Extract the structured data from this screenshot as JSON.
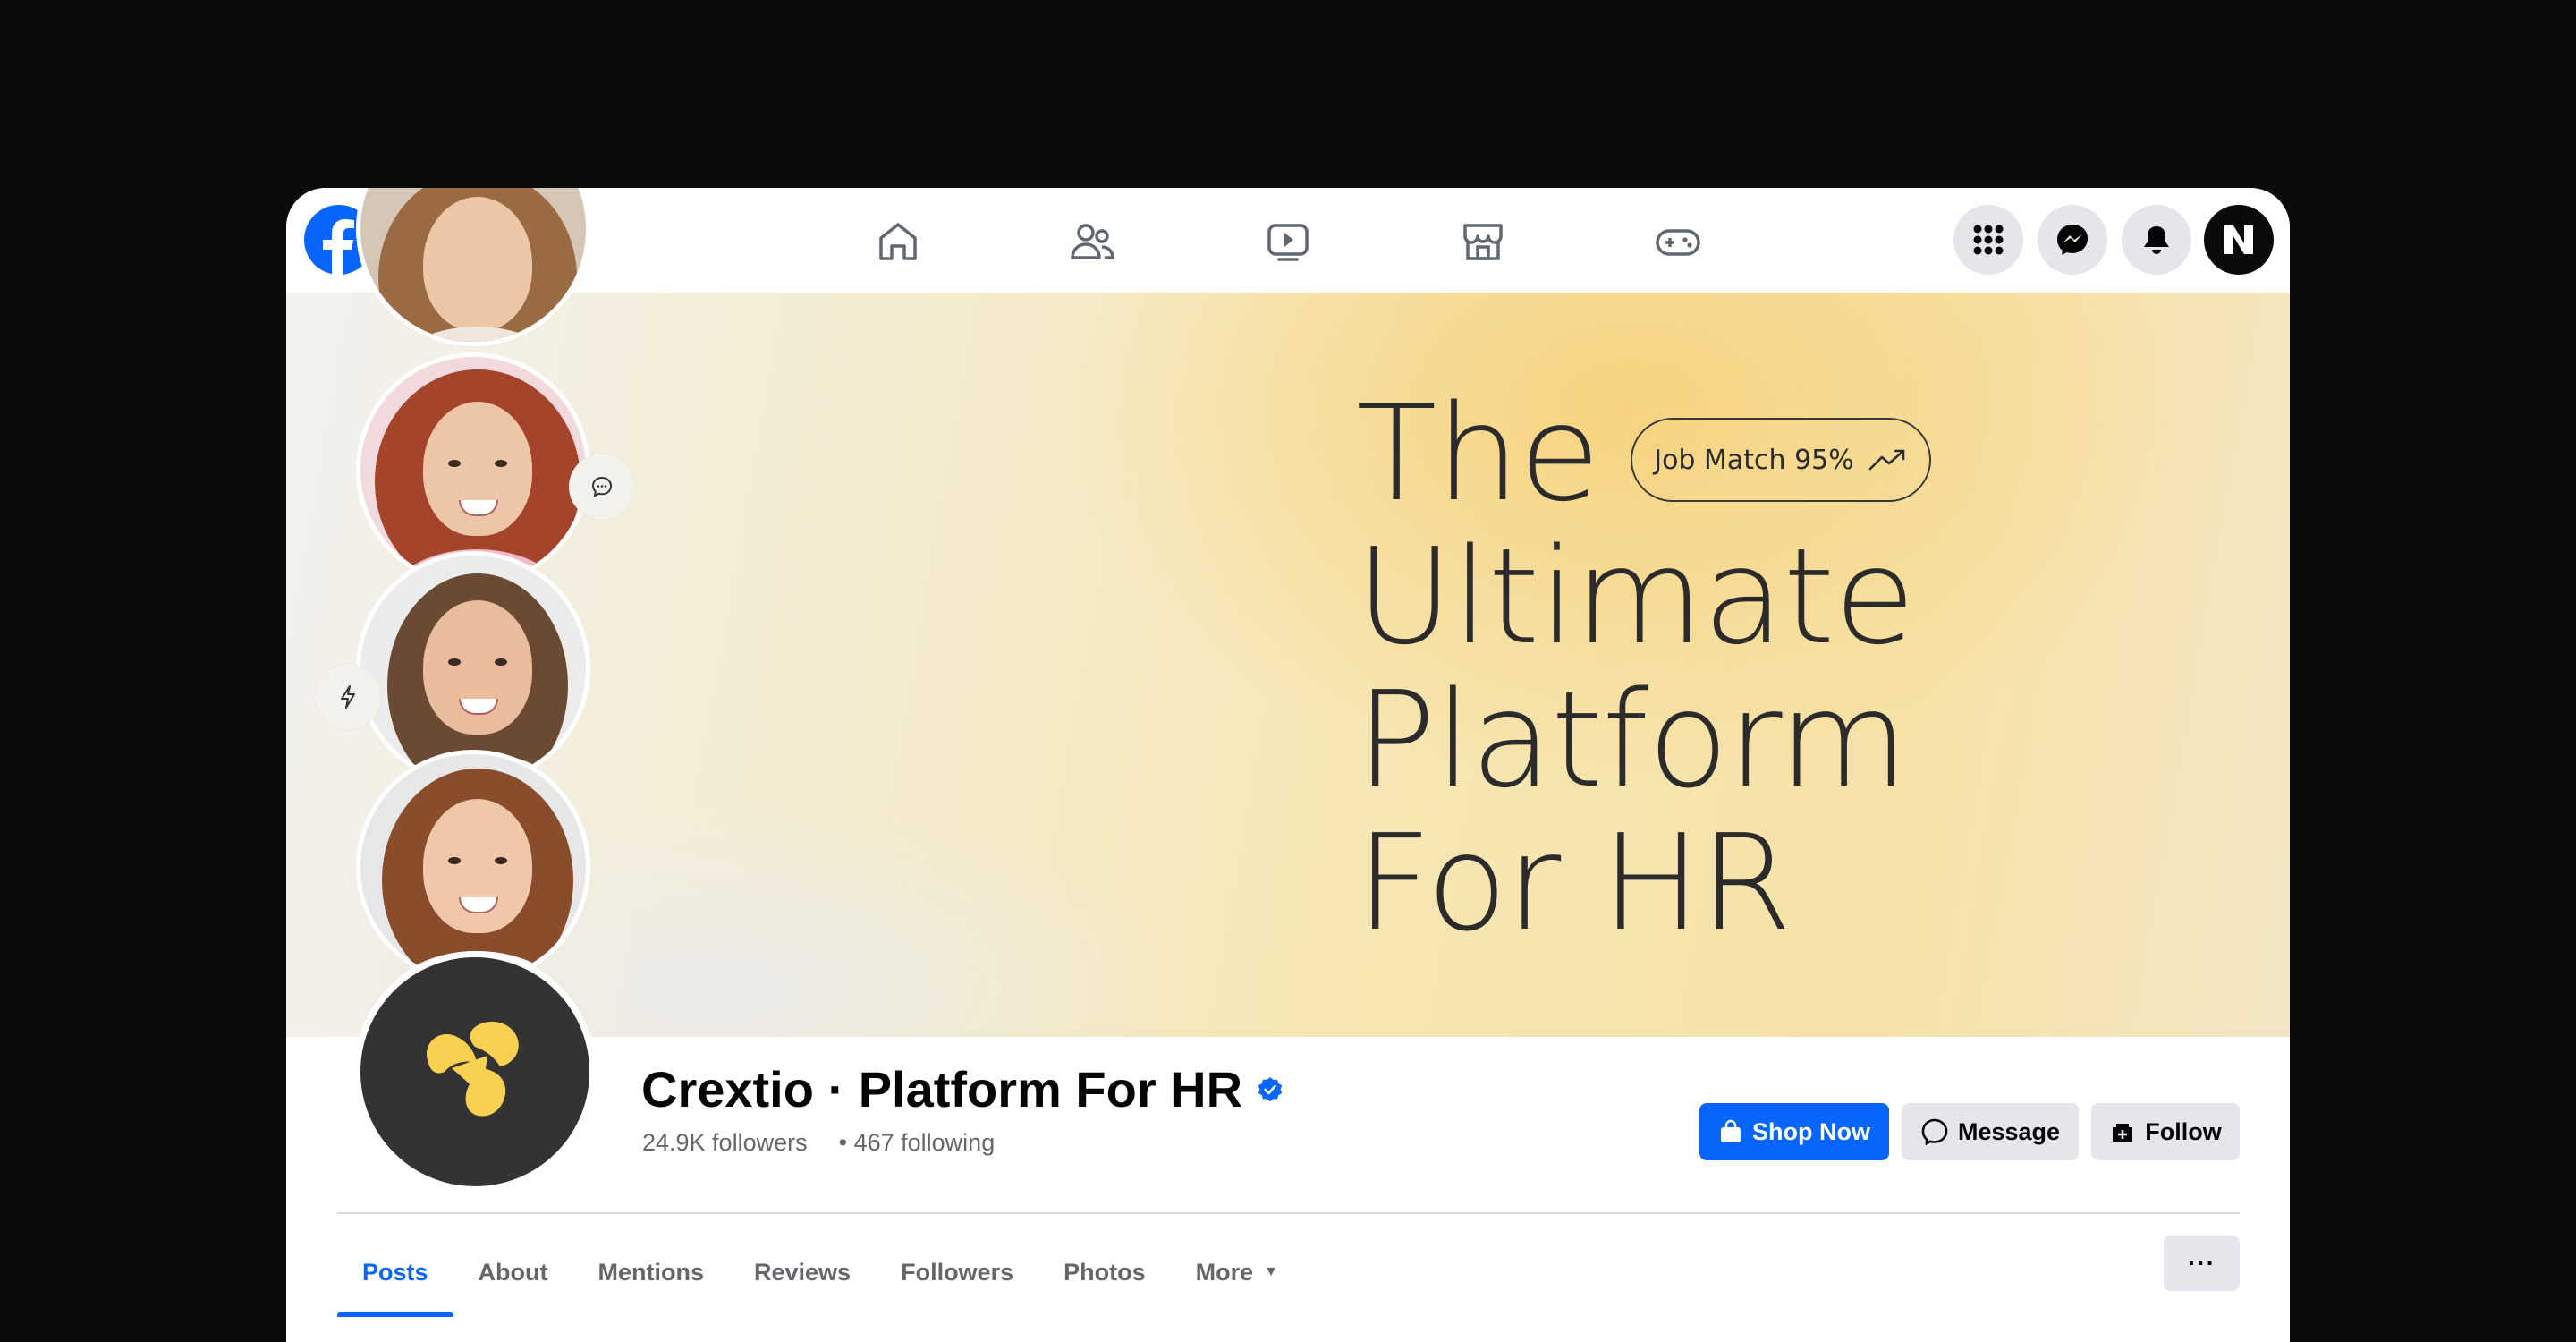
{
  "topbar": {
    "logo_icon": "facebook-logo-icon",
    "search_icon": "search-icon",
    "nav_icons": [
      "home-icon",
      "friends-icon",
      "watch-icon",
      "marketplace-icon",
      "gaming-icon"
    ],
    "right_icons": [
      "menu-grid-icon",
      "messenger-icon",
      "notifications-icon",
      "profile-avatar-icon"
    ]
  },
  "cover": {
    "headline": [
      "The",
      "Ultimate",
      "Platform",
      "For HR"
    ],
    "job_match": "Job Match 95%",
    "job_match_icon": "trend-up-icon",
    "chat_bubble_icon": "chat-bubble-icon",
    "lightning_icon": "lightning-icon"
  },
  "profile": {
    "name": "Crextio · Platform For HR",
    "verified_icon": "verified-badge-icon",
    "followers": "24.9K followers",
    "following": "• 467 following",
    "brand_color": "#0866ff",
    "logo_color": "#f8d152"
  },
  "actions": {
    "shop_now": "Shop Now",
    "message": "Message",
    "follow": "Follow"
  },
  "tabs": [
    "Posts",
    "About",
    "Mentions",
    "Reviews",
    "Followers",
    "Photos",
    "More"
  ],
  "more_options": "···"
}
